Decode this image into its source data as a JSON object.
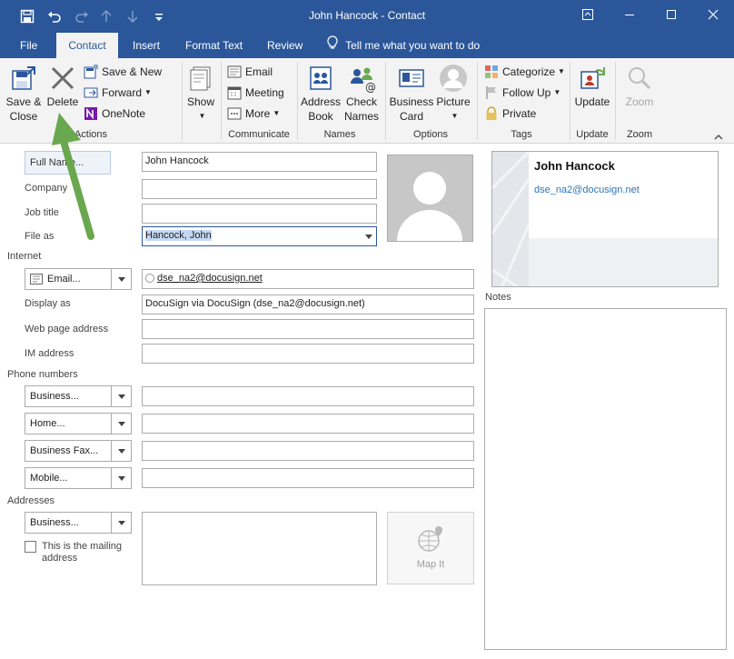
{
  "window": {
    "title": "John Hancock  -  Contact",
    "controls": [
      "minimize",
      "restore",
      "maximize",
      "close"
    ]
  },
  "quick_access": [
    "save-icon",
    "undo-icon",
    "redo-icon",
    "up-icon",
    "down-icon",
    "customize-icon"
  ],
  "tabs": [
    {
      "label": "File",
      "active": false
    },
    {
      "label": "Contact",
      "active": true
    },
    {
      "label": "Insert",
      "active": false
    },
    {
      "label": "Format Text",
      "active": false
    },
    {
      "label": "Review",
      "active": false
    }
  ],
  "tell_me": "Tell me what you want to do",
  "ribbon": {
    "actions": {
      "save_close_line1": "Save &",
      "save_close_line2": "Close",
      "delete": "Delete",
      "save_new": "Save & New",
      "forward": "Forward",
      "onenote": "OneNote",
      "label": "Actions"
    },
    "show": {
      "label": "Show"
    },
    "communicate": {
      "email": "Email",
      "meeting": "Meeting",
      "more": "More",
      "label": "Communicate"
    },
    "names": {
      "address_book_line1": "Address",
      "address_book_line2": "Book",
      "check_names_line1": "Check",
      "check_names_line2": "Names",
      "label": "Names"
    },
    "options": {
      "business_card_line1": "Business",
      "business_card_line2": "Card",
      "picture": "Picture",
      "label": "Options"
    },
    "tags": {
      "categorize": "Categorize",
      "follow_up": "Follow Up",
      "private": "Private",
      "label": "Tags"
    },
    "update": {
      "button": "Update",
      "label": "Update"
    },
    "zoom": {
      "button": "Zoom",
      "label": "Zoom"
    }
  },
  "form": {
    "full_name_btn": "Full Name...",
    "full_name": "John Hancock",
    "company_label": "Company",
    "company": "",
    "job_title_label": "Job title",
    "job_title": "",
    "file_as_label": "File as",
    "file_as": "Hancock, John",
    "internet_label": "Internet",
    "email_type": "Email...",
    "email": "dse_na2@docusign.net",
    "display_as_label": "Display as",
    "display_as": "DocuSign via DocuSign (dse_na2@docusign.net)",
    "web_page_label": "Web page address",
    "web_page": "",
    "im_label": "IM address",
    "im": "",
    "phone_label": "Phone numbers",
    "phones": [
      {
        "type": "Business...",
        "value": ""
      },
      {
        "type": "Home...",
        "value": ""
      },
      {
        "type": "Business Fax...",
        "value": ""
      },
      {
        "type": "Mobile...",
        "value": ""
      }
    ],
    "addresses_label": "Addresses",
    "address_type": "Business...",
    "address": "",
    "mailing_line1": "This is the mailing",
    "mailing_line2": "address",
    "mailing_checked": false,
    "map_it": "Map It"
  },
  "card": {
    "name": "John Hancock",
    "email": "dse_na2@docusign.net"
  },
  "notes_label": "Notes",
  "colors": {
    "brand": "#2b579a",
    "ribbon_bg": "#f3f3f3",
    "link": "#2e75b6",
    "arrow": "#6aa84f"
  }
}
